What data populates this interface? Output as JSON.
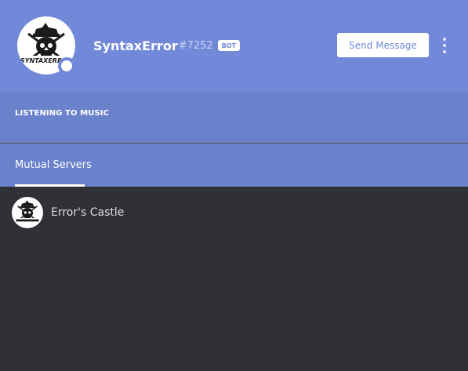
{
  "profile": {
    "username": "SyntaxError",
    "discriminator": "#7252",
    "bot_tag": "BOT",
    "avatar_logo_text": "SYNTAXERROR",
    "status": "online"
  },
  "header_actions": {
    "send_message_label": "Send Message",
    "more_icon": "vertical-ellipsis-icon"
  },
  "activity": {
    "label": "LISTENING TO MUSIC"
  },
  "tabs": [
    {
      "label": "Mutual Servers",
      "active": true
    }
  ],
  "mutual_servers": [
    {
      "name": "Error's Castle",
      "icon": "skull-pirate-logo"
    }
  ],
  "colors": {
    "accent": "#7289da",
    "accent_dark": "#6a81cc",
    "background": "#2f3136",
    "text_light": "#dcddde"
  }
}
